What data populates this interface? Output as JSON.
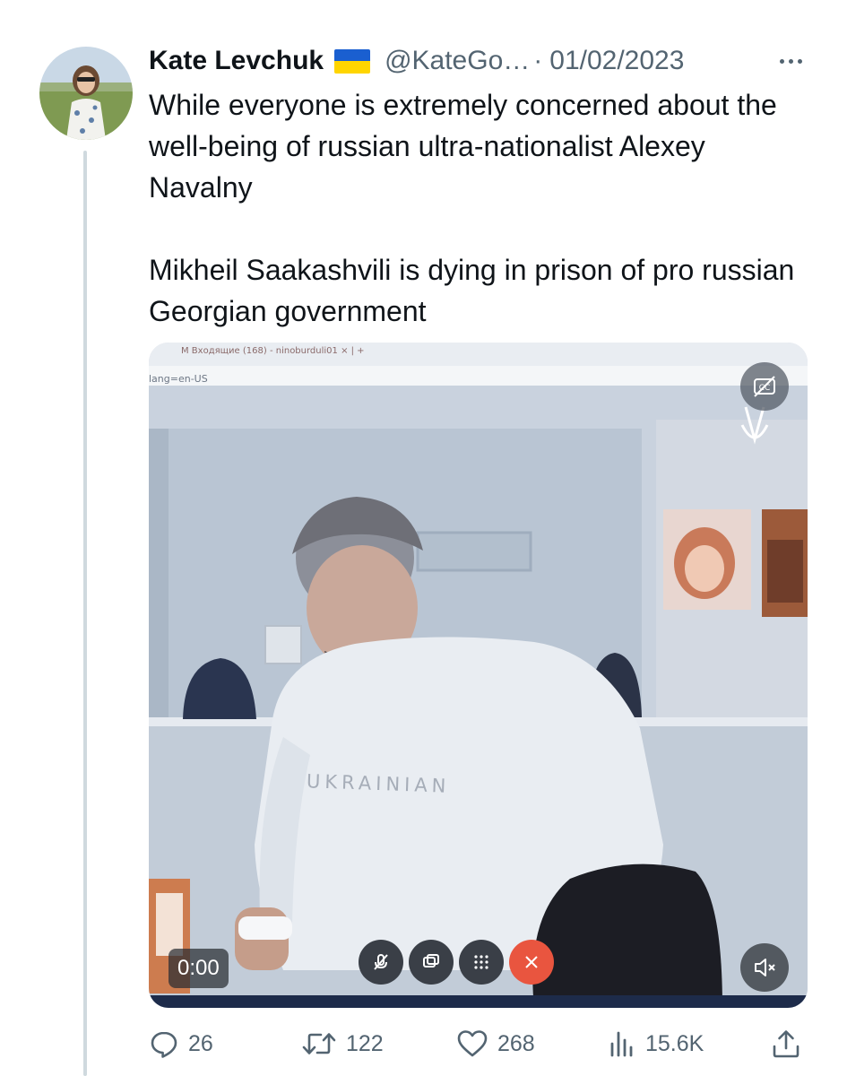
{
  "tweet": {
    "display_name": "Kate Levchuk",
    "handle": "@KateGo…",
    "separator": "·",
    "date": "01/02/2023",
    "text_paragraphs": [
      "While everyone is extremely concerned about the well-being of russian ultra-nationalist Alexey Navalny",
      "Mikheil Saakashvili is dying in prison of pro russian Georgian government"
    ]
  },
  "media": {
    "type": "video",
    "timestamp": "0:00",
    "browser_tab_text": "M  Входящие (168) - ninoburduli01   ×  |  +",
    "url_fragment": "lang=en-US",
    "shirt_text": "UKRAINIAN"
  },
  "actions": {
    "reply_count": "26",
    "retweet_count": "122",
    "like_count": "268",
    "view_count": "15.6K"
  },
  "icons": {
    "reply": "speech-bubble-icon",
    "retweet": "retweet-arrows-icon",
    "like": "heart-icon",
    "views": "bar-chart-icon",
    "share": "share-upload-icon",
    "more": "more-dots-icon",
    "captions": "closed-captions-icon",
    "mute": "speaker-muted-icon"
  },
  "colors": {
    "text_primary": "#0f1419",
    "text_secondary": "#536471",
    "thread_line": "#cfd9de",
    "flag_blue": "#1a5fd0",
    "flag_yellow": "#ffd500",
    "end_call_red": "#e9553f"
  }
}
